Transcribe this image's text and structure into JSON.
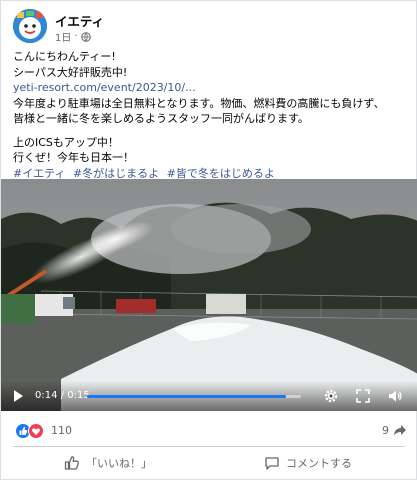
{
  "post": {
    "page_name": "イエティ",
    "time": "1日",
    "globe_icon": "globe-icon",
    "lines": {
      "greeting": "こんにちわんティー!",
      "season_pass": "シーパス大好評販売中!",
      "link": "yeti-resort.com/event/2023/10/...",
      "body1": "今年度より駐車場は全日無料となります。物価、燃料費の高騰にも負けず、",
      "body2": "皆様と一緒に冬を楽しめるようスタッフ一同がんばります。",
      "ics": "上のICSもアップ中！",
      "go": "行くぜ！今年も日本一！"
    },
    "hashtags": [
      "#イエティ",
      "#冬がはじまるよ",
      "#皆で冬をはじめるよ"
    ]
  },
  "video": {
    "current_time": "0:14",
    "separator": "/",
    "duration": "0:15",
    "progress": 0.93,
    "accent": "#1877f2"
  },
  "engagement": {
    "reaction_count": "110",
    "share_count": "9",
    "reaction_icons": [
      "like-icon",
      "love-icon"
    ]
  },
  "actions": {
    "like_label": "「いいね！」",
    "comment_label": "コメントする"
  },
  "colors": {
    "link": "#385898",
    "muted": "#65676b",
    "like_blue": "#1877f2",
    "love_red": "#f33e58"
  }
}
